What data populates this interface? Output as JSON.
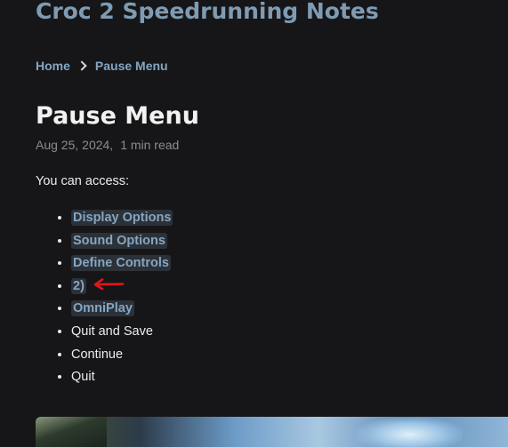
{
  "site": {
    "title": "Croc 2 Speedrunning Notes"
  },
  "breadcrumb": {
    "home": "Home",
    "current": "Pause Menu"
  },
  "article": {
    "title": "Pause Menu",
    "date": "Aug 25, 2024,",
    "read_time": "1 min read",
    "intro": "You can access:",
    "items": [
      {
        "label": "Display Options",
        "link": true
      },
      {
        "label": "Sound Options",
        "link": true
      },
      {
        "label": "Define Controls",
        "link": true
      },
      {
        "label": "2)",
        "link": true
      },
      {
        "label": "OmniPlay",
        "link": true
      },
      {
        "label": "Quit and Save",
        "link": false
      },
      {
        "label": "Continue",
        "link": false
      },
      {
        "label": "Quit",
        "link": false
      }
    ]
  },
  "colors": {
    "background": "#161618",
    "link": "#84a6c2",
    "link_bg": "#2c3138",
    "annotation_arrow": "#e0181d"
  },
  "icons": {
    "breadcrumb_separator": "chevron-right-icon",
    "annotation": "red-arrow-annotation"
  }
}
